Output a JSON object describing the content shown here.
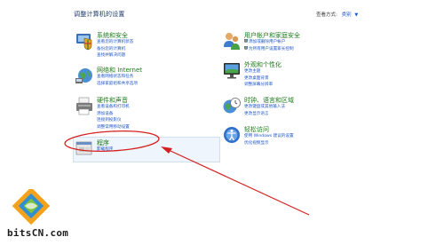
{
  "header": {
    "title": "调整计算机的设置",
    "view_label": "查看方式:",
    "view_mode": "类别"
  },
  "categories": {
    "system": {
      "title": "系统和安全",
      "icon": "shield-pc-icon",
      "links": [
        "查看您的计算机状态",
        "备份您的计算机",
        "查找并解决问题"
      ]
    },
    "network": {
      "title": "网络和 Internet",
      "icon": "network-globe-icon",
      "links": [
        "查看网络状态和任务",
        "选择家庭组和共享选项"
      ]
    },
    "hardware": {
      "title": "硬件和声音",
      "icon": "printer-icon",
      "links": [
        "查看设备和打印机",
        "添加设备",
        "连接到投影仪",
        "调整常用移动设置"
      ]
    },
    "programs": {
      "title": "程序",
      "icon": "programs-icon",
      "links": [
        "卸载程序"
      ]
    },
    "users": {
      "title": "用户帐户和家庭安全",
      "icon": "users-icon",
      "links": [
        "添加或删除用户帐户",
        "为所有用户设置家长控制"
      ]
    },
    "appearance": {
      "title": "外观和个性化",
      "icon": "monitor-icon",
      "links": [
        "更改主题",
        "更改桌面背景",
        "调整屏幕分辨率"
      ]
    },
    "clock": {
      "title": "时钟、语言和区域",
      "icon": "clock-globe-icon",
      "links": [
        "更改键盘或其他输入法",
        "更改显示语言"
      ]
    },
    "ease": {
      "title": "轻松访问",
      "icon": "ease-of-access-icon",
      "links": [
        "使用 Windows 建议的设置",
        "优化视频显示"
      ]
    }
  },
  "watermark": "bitsCN.com",
  "colors": {
    "category_title": "#1a7a1a",
    "link": "#1e56c8",
    "annotation": "#d42020"
  }
}
